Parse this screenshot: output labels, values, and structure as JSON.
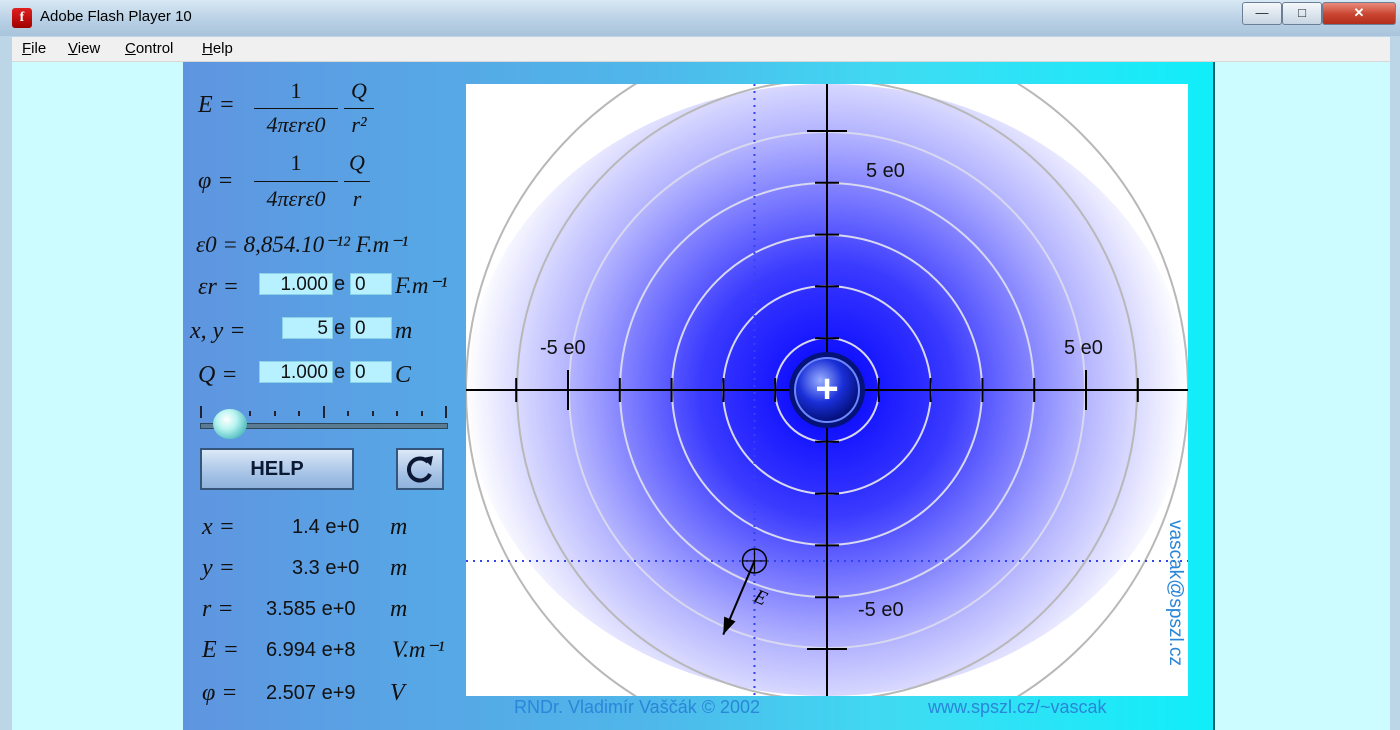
{
  "window": {
    "title": "Adobe Flash Player 10",
    "minimize": "—",
    "maximize": "□",
    "close": "✕"
  },
  "menu": [
    {
      "first": "F",
      "rest": "ile"
    },
    {
      "first": "V",
      "rest": "iew"
    },
    {
      "first": "C",
      "rest": "ontrol"
    },
    {
      "first": "H",
      "rest": "elp"
    }
  ],
  "formulas": {
    "E_lhs": "E =",
    "E_num": "1",
    "E_den": "4πεrε0",
    "E_q": "Q",
    "E_r": "r²",
    "phi_lhs": "φ =",
    "phi_num": "1",
    "phi_den": "4πεrε0",
    "phi_q": "Q",
    "phi_r": "r",
    "eps0": "ε0 = 8,854.10⁻¹² F.m⁻¹"
  },
  "inputs": {
    "eps_r_label": "εr =",
    "eps_r_mant": "1.000",
    "eps_r_exp": "0",
    "eps_r_unit": "F.m⁻¹",
    "xy_label": "x, y =",
    "xy_mant": "5",
    "xy_exp": "0",
    "xy_unit": "m",
    "Q_label": "Q =",
    "Q_mant": "1.000",
    "Q_exp": "0",
    "Q_unit": "C",
    "e": "e"
  },
  "buttons": {
    "help": "HELP",
    "reset_icon": "refresh-icon"
  },
  "results": [
    {
      "label": "x =",
      "value": "1.4 e+0",
      "unit": "m"
    },
    {
      "label": "y =",
      "value": "3.3 e+0",
      "unit": "m"
    },
    {
      "label": "r =",
      "value": "3.585 e+0",
      "unit": "m"
    },
    {
      "label": "E =",
      "value": "6.994 e+8",
      "unit": "V.m⁻¹"
    },
    {
      "label": "φ =",
      "value": "2.507 e+9",
      "unit": "V"
    }
  ],
  "plot": {
    "axis_labels": {
      "x_neg": "-5 e0",
      "x_pos": "5 e0",
      "y_pos": "5 e0",
      "y_neg": "-5 e0"
    },
    "charge_sign": "+",
    "field_vector_label": "E",
    "colors": {
      "field_center": "#0000ff",
      "field_edge": "#ffffff",
      "probe_line": "#3344ee"
    }
  },
  "credits": {
    "author": "RNDr. Vladimír Vaščák © 2002",
    "website": "www.spszl.cz/~vascak",
    "email": "vascak@spszl.cz"
  }
}
